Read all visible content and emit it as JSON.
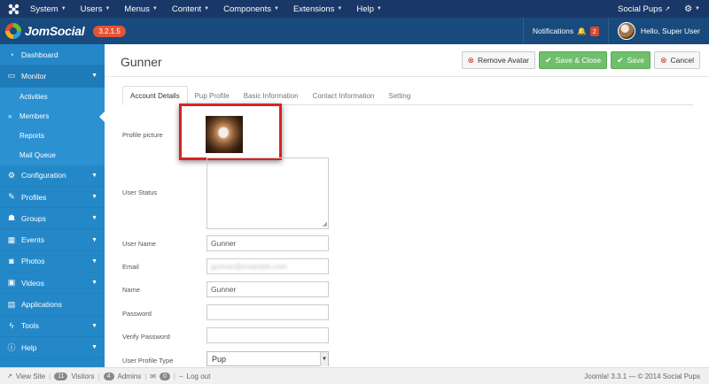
{
  "topbar": {
    "menu": [
      {
        "label": "System"
      },
      {
        "label": "Users"
      },
      {
        "label": "Menus"
      },
      {
        "label": "Content"
      },
      {
        "label": "Components"
      },
      {
        "label": "Extensions"
      },
      {
        "label": "Help"
      }
    ],
    "site_name": "Social Pups"
  },
  "header": {
    "brand": "JomSocial",
    "version": "3.2.1.5",
    "notifications_label": "Notifications",
    "notifications_count": "2",
    "greeting": "Hello, Super User"
  },
  "sidebar": {
    "items": [
      {
        "label": "Dashboard"
      },
      {
        "label": "Monitor"
      },
      {
        "label": "Configuration"
      },
      {
        "label": "Profiles"
      },
      {
        "label": "Groups"
      },
      {
        "label": "Events"
      },
      {
        "label": "Photos"
      },
      {
        "label": "Videos"
      },
      {
        "label": "Applications"
      },
      {
        "label": "Tools"
      },
      {
        "label": "Help"
      }
    ],
    "monitor_sub": [
      {
        "label": "Activities"
      },
      {
        "label": "Members"
      },
      {
        "label": "Reports"
      },
      {
        "label": "Mail Queue"
      }
    ]
  },
  "page": {
    "title": "Gunner",
    "buttons": {
      "remove_avatar": "Remove Avatar",
      "save_close": "Save & Close",
      "save": "Save",
      "cancel": "Cancel"
    },
    "tabs": [
      {
        "label": "Account Details"
      },
      {
        "label": "Pup Profile"
      },
      {
        "label": "Basic Information"
      },
      {
        "label": "Contact Information"
      },
      {
        "label": "Setting"
      }
    ]
  },
  "form": {
    "profile_picture_label": "Profile picture",
    "user_status_label": "User Status",
    "username_label": "User Name",
    "username_value": "Gunner",
    "email_label": "Email",
    "email_value": "gunner@example.com",
    "name_label": "Name",
    "name_value": "Gunner",
    "password_label": "Password",
    "verify_password_label": "Verify Password",
    "profile_type_label": "User Profile Type",
    "profile_type_value": "Pup"
  },
  "footer": {
    "view_site": "View Site",
    "visitors_count": "11",
    "visitors_label": "Visitors",
    "admins_count": "4",
    "admins_label": "Admins",
    "messages_count": "0",
    "logout": "Log out",
    "copyright": "Joomla! 3.3.1 — © 2014 Social Pups"
  },
  "colors": {
    "topbar": "#1a3867",
    "header": "#184a7d",
    "sidebar": "#2488c8",
    "accent_green": "#6fbf6c",
    "version_badge": "#e35436",
    "highlight_red": "#d62424"
  }
}
